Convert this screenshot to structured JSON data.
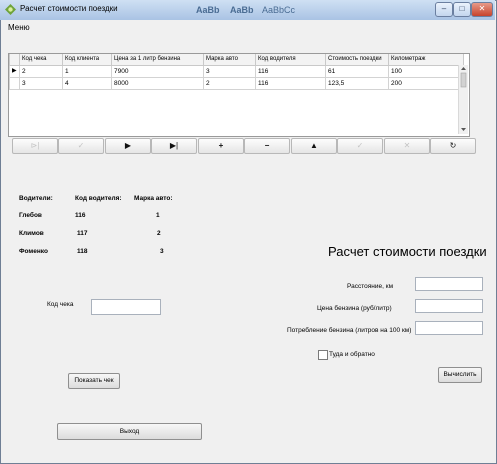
{
  "window": {
    "title": "Расчет стоимости поездки",
    "controls": {
      "minimize": "–",
      "maximize": "□",
      "close": "✕"
    }
  },
  "background_text": [
    "AaBb",
    "AaBb",
    "AaBbCc"
  ],
  "menu": {
    "label": "Меню"
  },
  "grid": {
    "columns": [
      "Код чека",
      "Код клиента",
      "Цена за 1 литр бензина",
      "Марка авто",
      "Код водителя",
      "Стоимость поездки",
      "Километраж"
    ],
    "rows": [
      {
        "marker": "▶",
        "cells": [
          "2",
          "1",
          "7900",
          "3",
          "116",
          "61",
          "100"
        ]
      },
      {
        "marker": "",
        "cells": [
          "3",
          "4",
          "8000",
          "2",
          "116",
          "123,5",
          "200"
        ]
      }
    ]
  },
  "navigator": [
    {
      "glyph": "⊳|",
      "enabled": false
    },
    {
      "glyph": "✓",
      "enabled": false
    },
    {
      "glyph": "▶",
      "enabled": true
    },
    {
      "glyph": "▶|",
      "enabled": true
    },
    {
      "glyph": "+",
      "enabled": true
    },
    {
      "glyph": "−",
      "enabled": true
    },
    {
      "glyph": "▲",
      "enabled": true
    },
    {
      "glyph": "✓",
      "enabled": false
    },
    {
      "glyph": "✕",
      "enabled": false
    },
    {
      "glyph": "↻",
      "enabled": true
    }
  ],
  "drivers": {
    "headers": [
      "Водители:",
      "Код водителя:",
      "Марка авто:"
    ],
    "rows": [
      {
        "name": "Глебов",
        "code": "116",
        "car": "1"
      },
      {
        "name": "Климов",
        "code": "117",
        "car": "2"
      },
      {
        "name": "Фоменко",
        "code": "118",
        "car": "3"
      }
    ]
  },
  "receipt": {
    "label": "Код чека",
    "value": ""
  },
  "show_button": "Показать чек",
  "exit_button": "Выход",
  "calculator": {
    "heading": "Расчет стоимости поездки",
    "distance_label": "Расстояние, км",
    "price_label": "Цена бензина (руб/литр)",
    "consumption_label": "Потребление бензина (литров на 100 км)",
    "roundtrip_label": "Туда и обратно",
    "calculate_button": "Вычислить"
  }
}
